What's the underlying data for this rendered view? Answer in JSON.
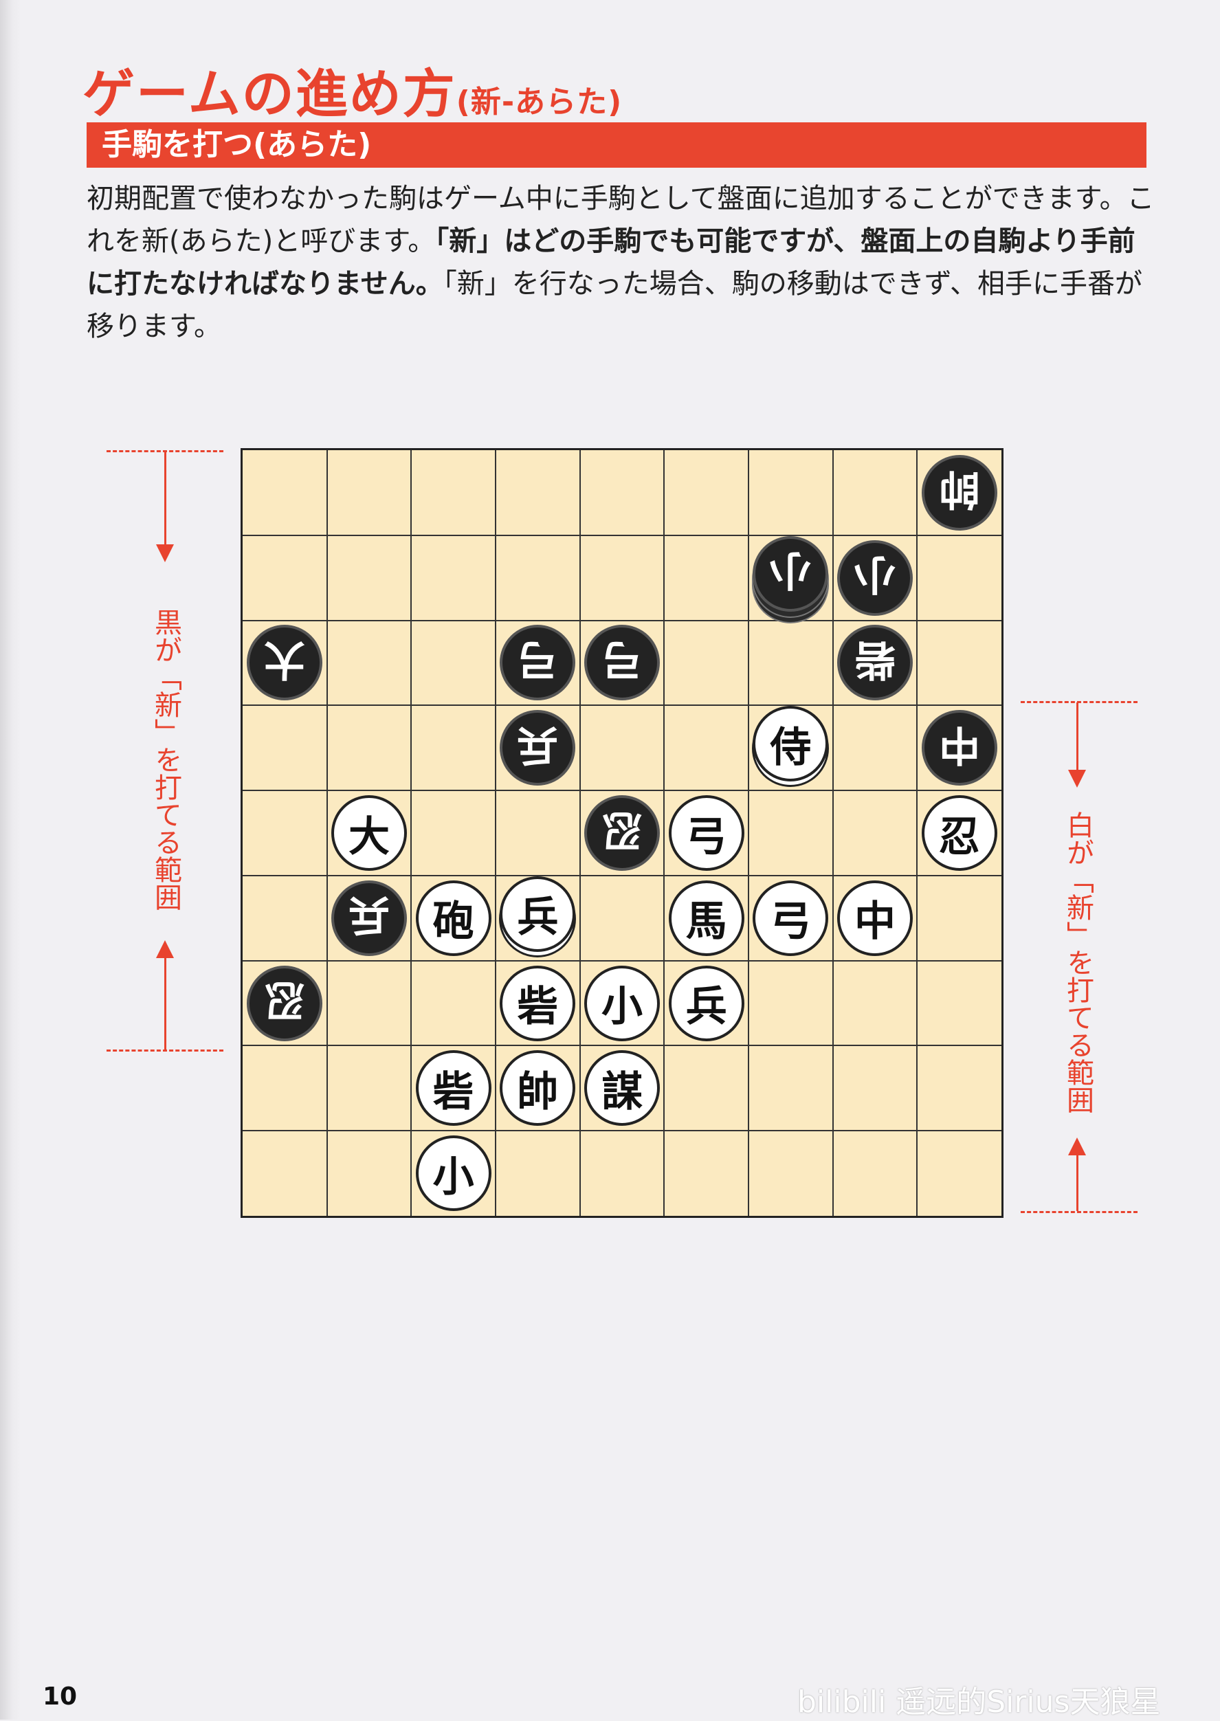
{
  "heading": {
    "main": "ゲームの進め方",
    "sub": "(新-あらた)"
  },
  "banner": "手駒を打つ(あらた)",
  "paragraph": {
    "part1": "初期配置で使わなかった駒はゲーム中に手駒として盤面に追加することができます。これを新(あらた)と呼びます。",
    "part2_bold": "「新」はどの手駒でも可能ですが、盤面上の自駒より手前に打たなければなりません。",
    "part3": "「新」を行なった場合、駒の移動はできず、相手に手番が移ります。"
  },
  "range_labels": {
    "black": "黒が「新」を打てる範囲",
    "white": "白が「新」を打てる範囲"
  },
  "board": {
    "rows": 9,
    "cols": 9,
    "pieces": [
      {
        "row": 0,
        "col": 8,
        "label": "帥",
        "side": "black",
        "stack": 1
      },
      {
        "row": 1,
        "col": 6,
        "label": "小",
        "side": "black",
        "stack": 3
      },
      {
        "row": 1,
        "col": 7,
        "label": "小",
        "side": "black",
        "stack": 1
      },
      {
        "row": 2,
        "col": 0,
        "label": "大",
        "side": "black",
        "stack": 1
      },
      {
        "row": 2,
        "col": 3,
        "label": "弓",
        "side": "black",
        "stack": 1
      },
      {
        "row": 2,
        "col": 4,
        "label": "弓",
        "side": "black",
        "stack": 1
      },
      {
        "row": 2,
        "col": 7,
        "label": "砦",
        "side": "black",
        "stack": 1
      },
      {
        "row": 3,
        "col": 3,
        "label": "兵",
        "side": "black",
        "stack": 1
      },
      {
        "row": 3,
        "col": 6,
        "label": "侍",
        "side": "white",
        "stack": 2
      },
      {
        "row": 3,
        "col": 8,
        "label": "中",
        "side": "black",
        "stack": 1
      },
      {
        "row": 4,
        "col": 1,
        "label": "大",
        "side": "white",
        "stack": 1
      },
      {
        "row": 4,
        "col": 4,
        "label": "忍",
        "side": "black",
        "stack": 1
      },
      {
        "row": 4,
        "col": 5,
        "label": "弓",
        "side": "white",
        "stack": 1
      },
      {
        "row": 4,
        "col": 8,
        "label": "忍",
        "side": "white",
        "stack": 1
      },
      {
        "row": 5,
        "col": 1,
        "label": "兵",
        "side": "black",
        "stack": 1
      },
      {
        "row": 5,
        "col": 2,
        "label": "砲",
        "side": "white",
        "stack": 1
      },
      {
        "row": 5,
        "col": 3,
        "label": "兵",
        "side": "white",
        "stack": 2
      },
      {
        "row": 5,
        "col": 5,
        "label": "馬",
        "side": "white",
        "stack": 1
      },
      {
        "row": 5,
        "col": 6,
        "label": "弓",
        "side": "white",
        "stack": 1
      },
      {
        "row": 5,
        "col": 7,
        "label": "中",
        "side": "white",
        "stack": 1
      },
      {
        "row": 6,
        "col": 0,
        "label": "忍",
        "side": "black",
        "stack": 1
      },
      {
        "row": 6,
        "col": 3,
        "label": "砦",
        "side": "white",
        "stack": 1
      },
      {
        "row": 6,
        "col": 4,
        "label": "小",
        "side": "white",
        "stack": 1
      },
      {
        "row": 6,
        "col": 5,
        "label": "兵",
        "side": "white",
        "stack": 1
      },
      {
        "row": 7,
        "col": 2,
        "label": "砦",
        "side": "white",
        "stack": 1
      },
      {
        "row": 7,
        "col": 3,
        "label": "帥",
        "side": "white",
        "stack": 1
      },
      {
        "row": 7,
        "col": 4,
        "label": "謀",
        "side": "white",
        "stack": 1
      },
      {
        "row": 8,
        "col": 2,
        "label": "小",
        "side": "white",
        "stack": 1
      }
    ]
  },
  "page_number": "10",
  "watermark": "bilibili 遥远的Sirius天狼星",
  "colors": {
    "accent": "#e8432e",
    "board": "#fbeac1"
  }
}
